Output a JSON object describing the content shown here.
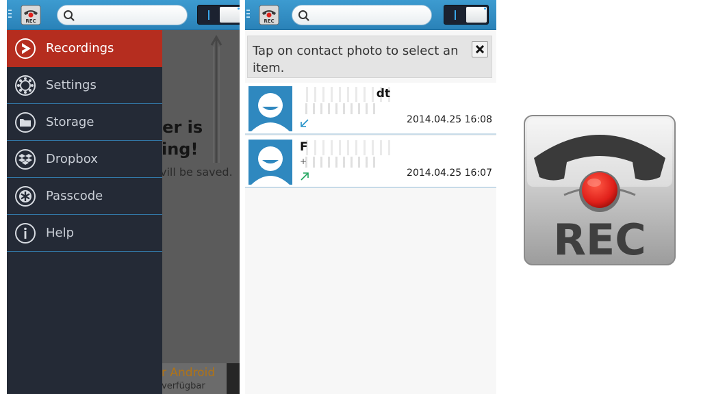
{
  "app": {
    "icon_label": "REC"
  },
  "screen1": {
    "menu": [
      {
        "label": "Recordings",
        "icon": "recordings-icon",
        "active": true
      },
      {
        "label": "Settings",
        "icon": "settings-gear-icon",
        "active": false
      },
      {
        "label": "Storage",
        "icon": "folder-icon",
        "active": false
      },
      {
        "label": "Dropbox",
        "icon": "dropbox-icon",
        "active": false
      },
      {
        "label": "Passcode",
        "icon": "passcode-icon",
        "active": false
      },
      {
        "label": "Help",
        "icon": "help-info-icon",
        "active": false
      }
    ],
    "background": {
      "title_line1": "der is",
      "title_line2": "king!",
      "subtitle": "vill be saved.",
      "ad_line1": "r Android",
      "ad_line2": "verfügbar"
    }
  },
  "screen2": {
    "hint": "Tap on contact photo to select an item.",
    "recordings": [
      {
        "name": "dt",
        "number": "",
        "time": "2014.04.25 16:08",
        "direction": "incoming"
      },
      {
        "name": "F",
        "number": "+",
        "time": "2014.04.25 16:07",
        "direction": "outgoing"
      }
    ]
  },
  "logo": {
    "label": "REC"
  },
  "colors": {
    "topbar": "#2f8ac2",
    "drawer": "#242a36",
    "active_item": "#b52d1f",
    "divider": "#3278a8",
    "photo_bg": "#2f88bf",
    "rec_red": "#e0201a"
  }
}
